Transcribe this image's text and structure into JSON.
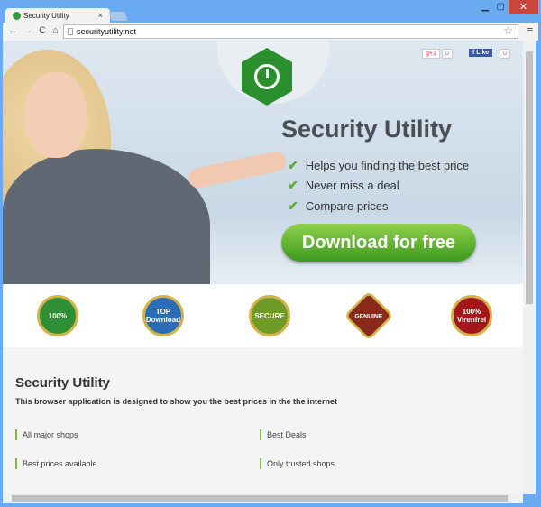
{
  "browser": {
    "tab_title": "Security Utility",
    "url": "securityutility.net"
  },
  "social": {
    "gplus_label": "g+1",
    "gplus_count": "0",
    "fb_label": "f Like",
    "fb_count": "0"
  },
  "hero": {
    "title": "Security Utility",
    "features": [
      "Helps you finding the best price",
      "Never miss a deal",
      "Compare prices"
    ],
    "download_label": "Download for free"
  },
  "badges": [
    {
      "label": "100%",
      "color": "#2e8f35"
    },
    {
      "label": "TOP Download",
      "color": "#2a6db5"
    },
    {
      "label": "SECURE",
      "color": "#6e9a28"
    },
    {
      "label": "GENUINE",
      "color": "#8a2a1a"
    },
    {
      "label": "100% Virenfrei",
      "color": "#a3161a"
    }
  ],
  "info": {
    "title": "Security Utility",
    "subtitle": "This browser application is designed to show you the best prices in the the internet",
    "features": [
      "All major shops",
      "Best Deals",
      "Best prices available",
      "Only trusted shops"
    ]
  }
}
